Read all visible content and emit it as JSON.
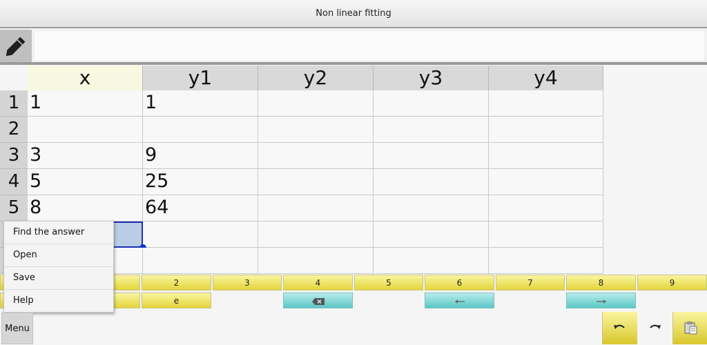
{
  "app": {
    "title": "Non linear fitting"
  },
  "editor": {
    "formula_value": "",
    "pencil_icon": "pencil-icon"
  },
  "table": {
    "columns": [
      "x",
      "y1",
      "y2",
      "y3",
      "y4"
    ],
    "rows": [
      {
        "label": "1",
        "cells": [
          "1",
          "1",
          "",
          "",
          ""
        ]
      },
      {
        "label": "2",
        "cells": [
          "",
          "",
          "",
          "",
          ""
        ]
      },
      {
        "label": "3",
        "cells": [
          "3",
          "9",
          "",
          "",
          ""
        ]
      },
      {
        "label": "4",
        "cells": [
          "5",
          "25",
          "",
          "",
          ""
        ]
      },
      {
        "label": "5",
        "cells": [
          "8",
          "64",
          "",
          "",
          ""
        ]
      },
      {
        "label": "",
        "cells": [
          "",
          "",
          "",
          "",
          ""
        ]
      },
      {
        "label": "",
        "cells": [
          "",
          "",
          "",
          "",
          ""
        ]
      }
    ]
  },
  "keypad": {
    "row1": [
      "",
      "2",
      "3",
      "4",
      "5",
      "6",
      "7",
      "8",
      "9"
    ],
    "row2": [
      "",
      "e",
      "backspace",
      "arrow-left",
      "arrow-right"
    ]
  },
  "menu": {
    "button_label": "Menu",
    "items": [
      "Find the answer",
      "Open",
      "Save",
      "Help"
    ]
  },
  "toolbar": {
    "icons": [
      "undo-icon",
      "redo-icon",
      "paste-icon"
    ]
  },
  "colors": {
    "key_yellow": "#f3e96a",
    "key_teal": "#5cc7c6",
    "selection_blue": "#1a2eb5"
  }
}
